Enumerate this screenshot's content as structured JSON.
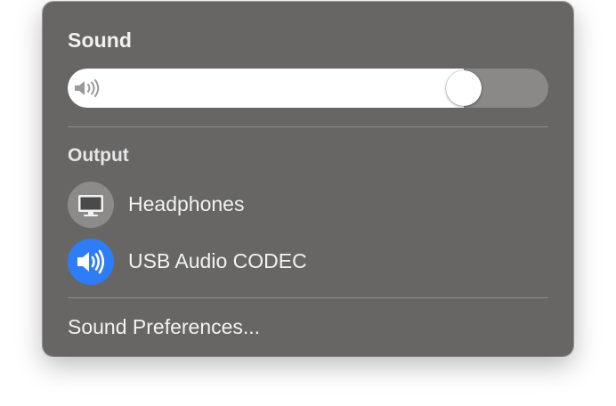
{
  "menu": {
    "title": "Sound",
    "volume": {
      "level": 0.85,
      "icon": "speaker-volume-icon",
      "fill_color": "#ffffff",
      "track_color": "#8a8988"
    },
    "output": {
      "label": "Output",
      "devices": [
        {
          "name": "Headphones",
          "icon": "display-icon",
          "selected": false,
          "icon_bg": "#8c8b8a"
        },
        {
          "name": "USB Audio CODEC",
          "icon": "speaker-icon",
          "selected": true,
          "icon_bg": "#2e7cf6"
        }
      ]
    },
    "preferences_label": "Sound Preferences..."
  },
  "colors": {
    "panel_bg": "#676665",
    "accent": "#2e7cf6",
    "text": "#f2f2f2"
  }
}
